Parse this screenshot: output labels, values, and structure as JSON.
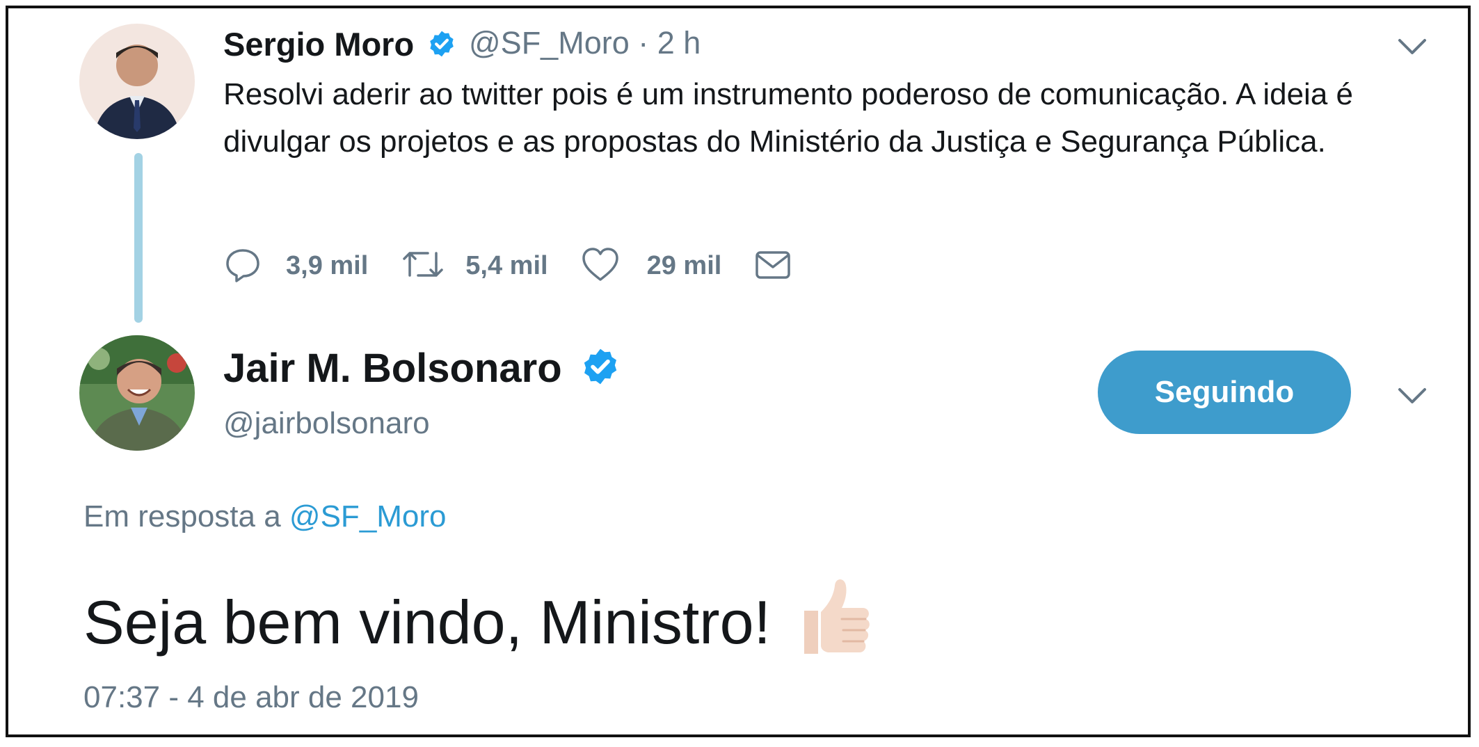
{
  "tweet1": {
    "name": "Sergio Moro",
    "handle": "@SF_Moro",
    "time": "· 2 h",
    "text": "Resolvi aderir ao twitter pois é um instrumento poderoso de comunicação. A ideia é divulgar os projetos e as propostas do Ministério da Justiça e Segurança Pública.",
    "replies": "3,9 mil",
    "retweets": "5,4 mil",
    "likes": "29 mil",
    "icons": [
      "reply-icon",
      "retweet-icon",
      "like-icon",
      "message-icon",
      "chevron-down-icon",
      "verified-icon"
    ]
  },
  "tweet2": {
    "name": "Jair M. Bolsonaro",
    "handle": "@jairbolsonaro",
    "follow_label": "Seguindo",
    "reply_prefix": "Em resposta a",
    "reply_handle": "@SF_Moro",
    "text": "Seja bem vindo, Ministro!",
    "emoji": "thumbs-up-icon",
    "timestamp": "07:37 - 4 de abr de 2019"
  },
  "colors": {
    "accent": "#3e9ccc",
    "link": "#2b9bd4",
    "verified": "#1da1f2",
    "muted": "#657786",
    "thread_line": "#a3d2e4"
  }
}
